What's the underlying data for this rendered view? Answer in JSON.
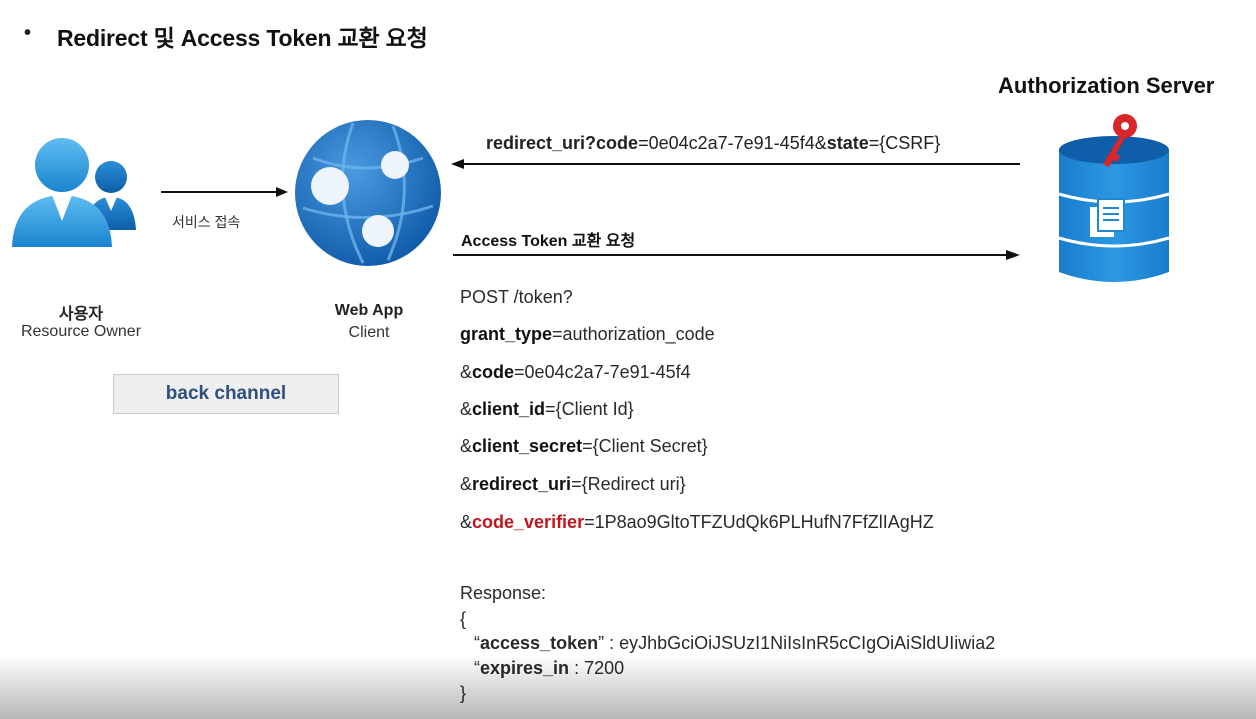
{
  "slide": {
    "bullet": "•",
    "title": "Redirect 및 Access Token 교환 요청"
  },
  "actors": {
    "user": {
      "name": "사용자",
      "role": "Resource Owner",
      "icon": "user-group-icon"
    },
    "webapp": {
      "name": "Web App",
      "role": "Client",
      "icon": "web-app-globe-icon"
    },
    "auth_server": {
      "name": "Authorization Server",
      "icon": "database-key-icon"
    }
  },
  "arrows": {
    "service_access": "서비스 접속",
    "redirect": {
      "key1": "redirect_uri?code",
      "val1": "=0e04c2a7-7e91-45f4&",
      "key2": "state",
      "val2": "={CSRF}"
    },
    "token_request": "Access Token 교환 요청"
  },
  "back_channel": "back channel",
  "request": {
    "line": "POST /token?",
    "params": [
      {
        "prefix": "",
        "key": "grant_type",
        "value": "=authorization_code"
      },
      {
        "prefix": "&",
        "key": "code",
        "value": "=0e04c2a7-7e91-45f4"
      },
      {
        "prefix": "&",
        "key": "client_id",
        "value": "={Client Id}"
      },
      {
        "prefix": "&",
        "key": "client_secret",
        "value": "={Client Secret}"
      },
      {
        "prefix": "&",
        "key": "redirect_uri",
        "value": "={Redirect uri}"
      }
    ],
    "verifier": {
      "prefix": "&",
      "key": "code_verifier",
      "value": "=1P8ao9GltoTFZUdQk6PLHufN7FfZlIAgHZ"
    }
  },
  "response": {
    "label": "Response:",
    "open": "{",
    "access_token": {
      "quote": "“",
      "key": "access_token",
      "endquote": "”",
      "value": " : eyJhbGciOiJSUzI1NiIsInR5cCIgOiAiSldUIiwia2"
    },
    "expires_in": {
      "quote": "“",
      "key": "expires_in",
      "value": " : 7200"
    },
    "close": "}"
  },
  "colors": {
    "accent_red": "#c0161d",
    "user_icon": "#1f8fd6",
    "globe": "#1e6fbf",
    "db": "#1f86d1",
    "key": "#d9262b",
    "back_channel_text": "#2f4f7f"
  }
}
